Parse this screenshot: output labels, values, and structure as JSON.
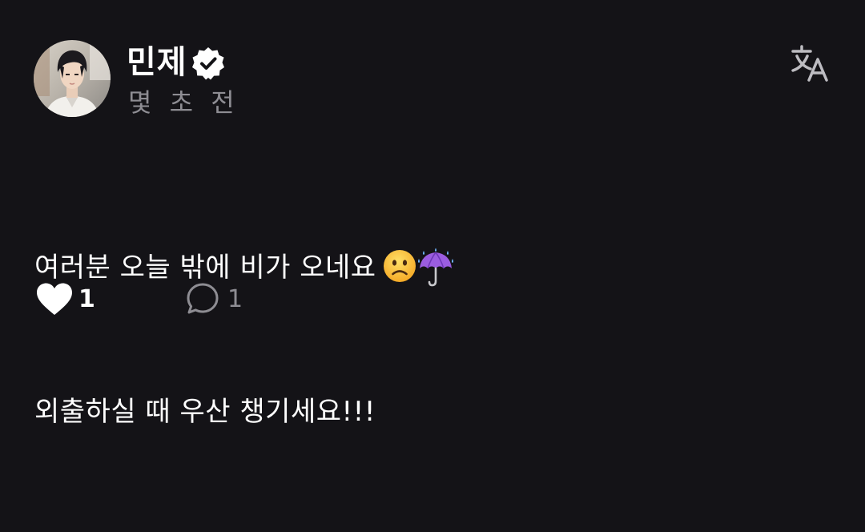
{
  "post": {
    "author": "민제",
    "verified": true,
    "timestamp": "몇 초 전",
    "text_line1": "여러분 오늘 밖에 비가 오네요",
    "text_line2": "외출하실 때 우산 챙기세요!!!",
    "emojis": [
      "frowning-face",
      "umbrella-with-rain-drops"
    ],
    "likes": "1",
    "replies": "1",
    "liked": true
  },
  "icons": {
    "verified": "verified-badge-icon",
    "translate": "translate-icon",
    "like": "heart-icon",
    "reply": "speech-bubble-icon"
  },
  "colors": {
    "background": "#141317",
    "text": "#ffffff",
    "muted": "#8e8d93"
  }
}
